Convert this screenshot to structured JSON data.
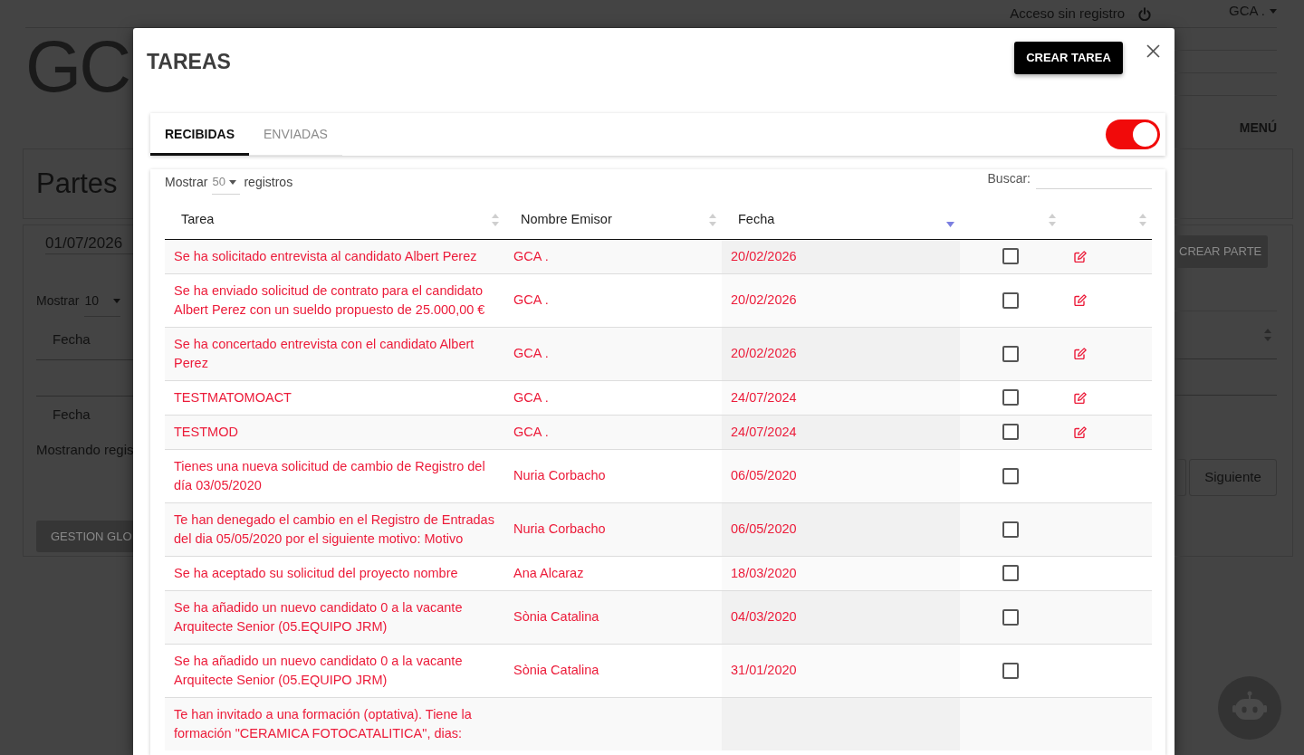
{
  "page": {
    "header": {
      "access_link": "Acceso sin registro",
      "user_menu": "GCA .",
      "logo": "GC",
      "menu": "MENÚ"
    },
    "left_panel": {
      "title": "Partes",
      "date": "01/07/2026",
      "length_label": "Mostrar",
      "length_value": "10",
      "column_header": "Fecha",
      "footer_header": "Fecha",
      "info": "Mostrando regis",
      "button": "GESTION GLO"
    },
    "right_panel": {
      "create_button": "CREAR PARTE",
      "next_button": "Siguiente"
    }
  },
  "modal": {
    "title": "TAREAS",
    "create_button": "CREAR TAREA",
    "tabs": [
      {
        "label": "RECIBIDAS",
        "selected": true
      },
      {
        "label": "ENVIADAS",
        "selected": false
      }
    ],
    "toggle": {
      "on": true
    },
    "length": {
      "label": "Mostrar",
      "value": "50",
      "suffix": "registros"
    },
    "search": {
      "label": "Buscar:"
    },
    "table": {
      "columns": [
        {
          "label": "Tarea",
          "sorted": false
        },
        {
          "label": "Nombre Emisor",
          "sorted": false
        },
        {
          "label": "Fecha",
          "sorted": true
        },
        {
          "sorted": false
        },
        {
          "sorted": false
        }
      ],
      "rows": [
        {
          "tarea": "Se ha solicitado entrevista al candidato Albert Perez",
          "emisor": "GCA .",
          "fecha": "20/02/2026",
          "checked": false,
          "editable": true
        },
        {
          "tarea": "Se ha enviado solicitud de contrato para el candidato Albert Perez con un sueldo propuesto de 25.000,00 €",
          "emisor": "GCA .",
          "fecha": "20/02/2026",
          "checked": false,
          "editable": true
        },
        {
          "tarea": "Se ha concertado entrevista con el candidato Albert Perez",
          "emisor": "GCA .",
          "fecha": "20/02/2026",
          "checked": false,
          "editable": true
        },
        {
          "tarea": "TESTMATOMOACT",
          "emisor": "GCA .",
          "fecha": "24/07/2024",
          "checked": false,
          "editable": true
        },
        {
          "tarea": "TESTMOD",
          "emisor": "GCA .",
          "fecha": "24/07/2024",
          "checked": false,
          "editable": true
        },
        {
          "tarea": "Tienes una nueva solicitud de cambio de Registro del día 03/05/2020",
          "emisor": "Nuria Corbacho",
          "fecha": "06/05/2020",
          "checked": false,
          "editable": false
        },
        {
          "tarea": "Te han denegado el cambio en el Registro de Entradas del dia 05/05/2020 por el siguiente motivo: Motivo",
          "emisor": "Nuria Corbacho",
          "fecha": "06/05/2020",
          "checked": false,
          "editable": false
        },
        {
          "tarea": "Se ha aceptado su solicitud del proyecto nombre",
          "emisor": "Ana Alcaraz",
          "fecha": "18/03/2020",
          "checked": false,
          "editable": false
        },
        {
          "tarea": "Se ha añadido un nuevo candidato 0 a la vacante Arquitecte Senior (05.EQUIPO JRM)",
          "emisor": "Sònia Catalina",
          "fecha": "04/03/2020",
          "checked": false,
          "editable": false
        },
        {
          "tarea": "Se ha añadido un nuevo candidato 0 a la vacante Arquitecte Senior (05.EQUIPO JRM)",
          "emisor": "Sònia Catalina",
          "fecha": "31/01/2020",
          "checked": false,
          "editable": false
        },
        {
          "tarea": "Te han invitado a una formación (optativa). Tiene la formación \"CERAMICA FOTOCATALITICA\", dias:"
        }
      ]
    }
  }
}
